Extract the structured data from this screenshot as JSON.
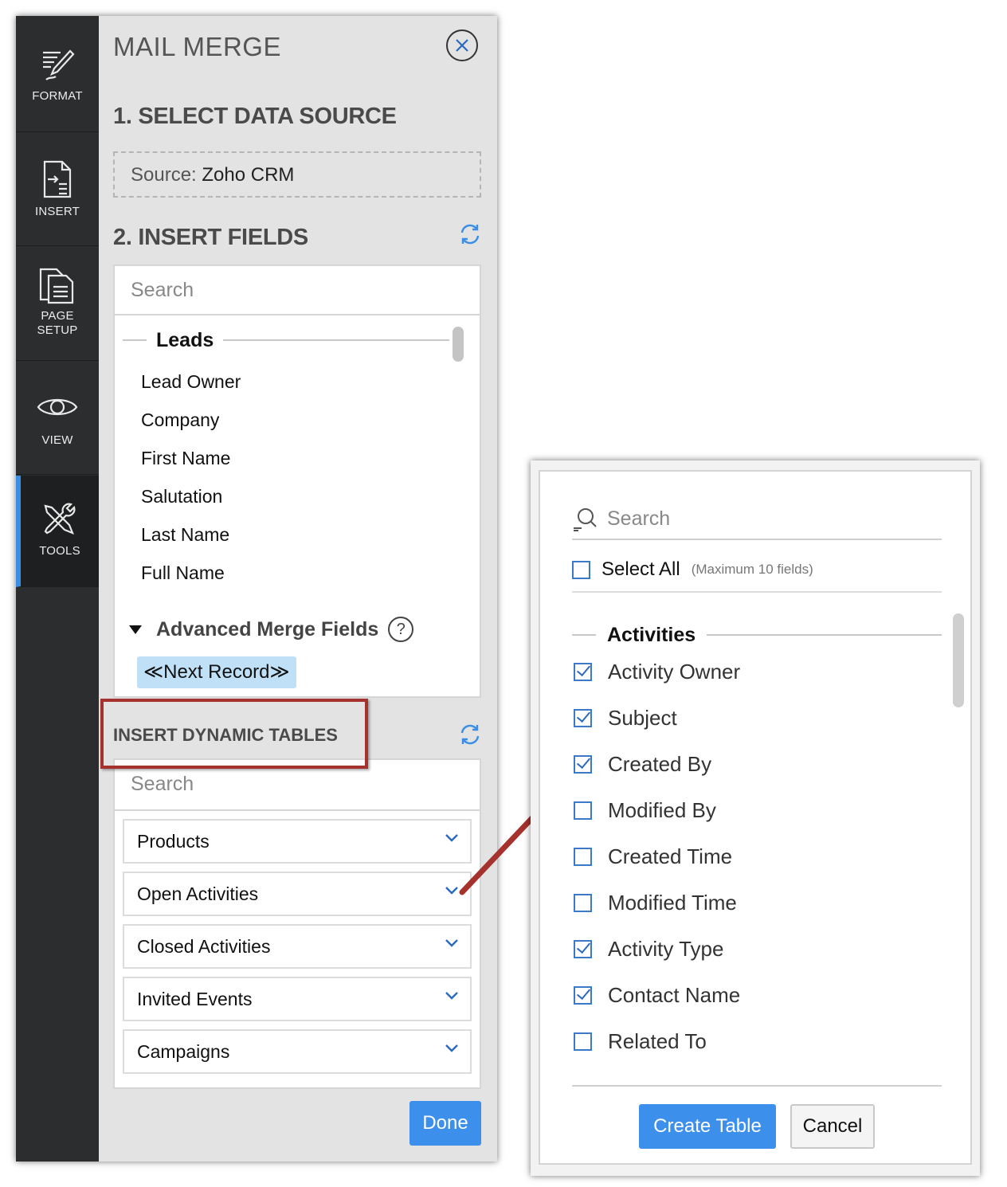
{
  "rail": {
    "items": [
      {
        "label": "FORMAT",
        "icon": "format-pen-icon"
      },
      {
        "label": "INSERT",
        "icon": "insert-doc-icon"
      },
      {
        "label_line1": "PAGE",
        "label_line2": "SETUP",
        "icon": "page-setup-icon"
      },
      {
        "label": "VIEW",
        "icon": "eye-icon"
      },
      {
        "label": "TOOLS",
        "icon": "tools-icon",
        "active": true
      }
    ]
  },
  "panel": {
    "title": "MAIL MERGE",
    "section1": "1. SELECT DATA SOURCE",
    "source_label": "Source:",
    "source_value": "Zoho CRM",
    "section2": "2. INSERT FIELDS",
    "fields_search_placeholder": "Search",
    "group_name": "Leads",
    "lead_fields": [
      "Lead Owner",
      "Company",
      "First Name",
      "Salutation",
      "Last Name",
      "Full Name"
    ],
    "advanced_label": "Advanced Merge Fields",
    "help_symbol": "?",
    "next_record": "≪Next Record≫",
    "dynamic_tables_head": "INSERT DYNAMIC TABLES",
    "tables_search_placeholder": "Search",
    "tables": [
      "Products",
      "Open Activities",
      "Closed Activities",
      "Invited Events",
      "Campaigns"
    ],
    "done_label": "Done"
  },
  "popup": {
    "search_placeholder": "Search",
    "select_all": "Select All",
    "max_note": "(Maximum 10 fields)",
    "group_name": "Activities",
    "options": [
      {
        "label": "Activity Owner",
        "checked": true
      },
      {
        "label": "Subject",
        "checked": true
      },
      {
        "label": "Created By",
        "checked": true
      },
      {
        "label": "Modified By",
        "checked": false
      },
      {
        "label": "Created Time",
        "checked": false
      },
      {
        "label": "Modified Time",
        "checked": false
      },
      {
        "label": "Activity Type",
        "checked": true
      },
      {
        "label": "Contact Name",
        "checked": true
      },
      {
        "label": "Related To",
        "checked": false
      }
    ],
    "create_label": "Create Table",
    "cancel_label": "Cancel"
  },
  "colors": {
    "accent": "#3c8fea",
    "highlight_border": "#a5322c",
    "rail_bg": "#2b2d2f",
    "chip_bg": "#bfe0f6"
  }
}
